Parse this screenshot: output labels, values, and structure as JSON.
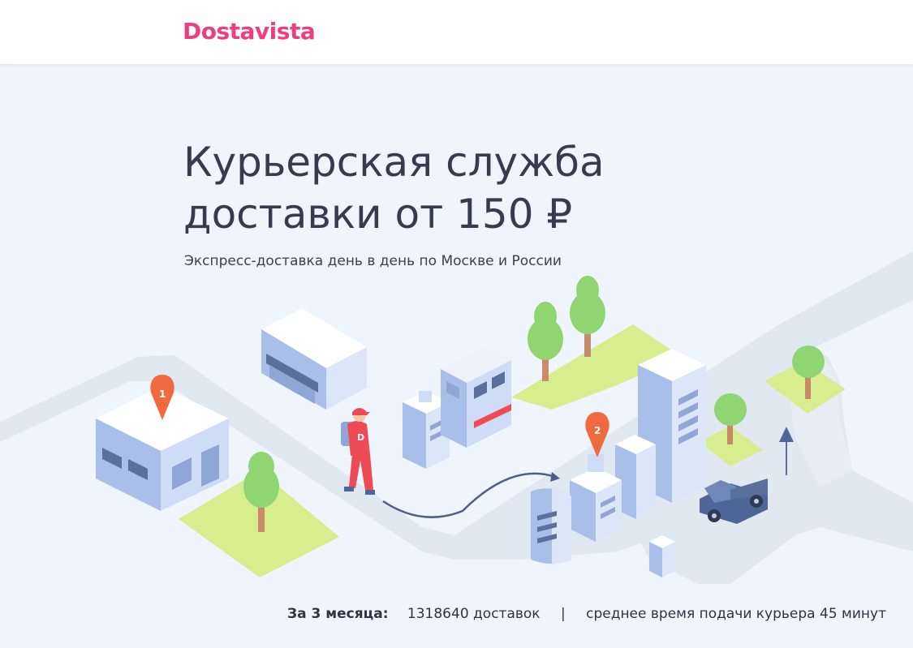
{
  "header": {
    "logo_text": "Dostavista",
    "brand_color": "#ee3d82"
  },
  "hero": {
    "title_line1": "Курьерская служба",
    "title_line2": "доставки от 150 ₽",
    "subtitle": "Экспресс-доставка день в день по Москве и России"
  },
  "illustration": {
    "pin1_label": "1",
    "pin2_label": "2",
    "courier_shirt_letter": "D",
    "pin_color": "#ef6a3f",
    "grass_color": "#d6ee8e",
    "building_color": "#a9bee9",
    "road_color": "#e0e8f2"
  },
  "stats": {
    "label": "За 3 месяца:",
    "deliveries": "1318640 доставок",
    "separator": "|",
    "avg_time": "среднее время подачи курьера 45 минут"
  }
}
